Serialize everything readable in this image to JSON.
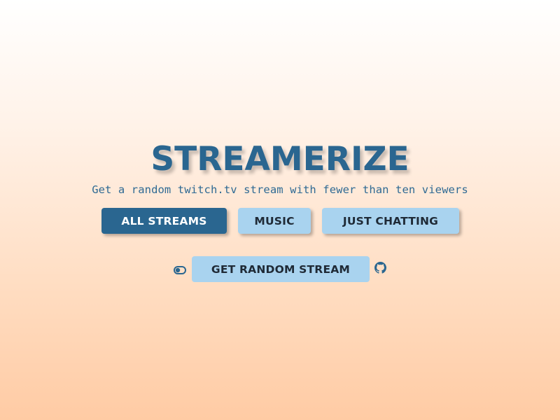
{
  "header": {
    "title": "STREAMERIZE",
    "subtitle": "Get a random twitch.tv stream with fewer than ten viewers"
  },
  "categories": [
    {
      "label": "ALL STREAMS",
      "active": true
    },
    {
      "label": "MUSIC",
      "active": false
    },
    {
      "label": "JUST CHATTING",
      "active": false
    }
  ],
  "actions": {
    "random_label": "GET RANDOM STREAM",
    "toggle_icon": "toggle-icon",
    "github_icon": "github-icon"
  },
  "colors": {
    "primary": "#2a6690",
    "secondary": "#a9d3ef",
    "dark_text": "#1f2a36",
    "background_top": "#ffffff",
    "background_bottom": "#ffcba4"
  }
}
